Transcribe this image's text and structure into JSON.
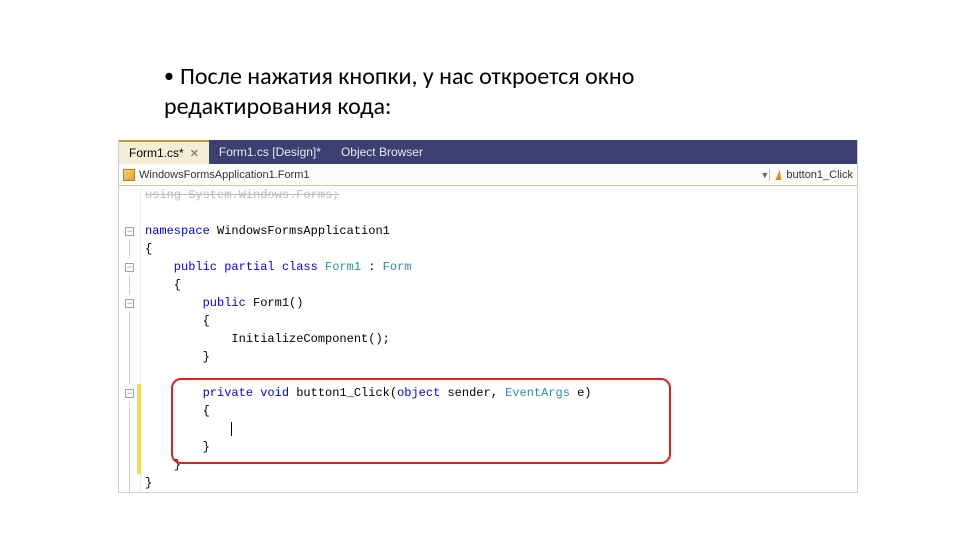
{
  "bullet_text": "После  нажатия кнопки, у нас откроется окно редактирования кода:",
  "tabs": {
    "active": "Form1.cs*",
    "design": "Form1.cs [Design]*",
    "browser": "Object Browser"
  },
  "nav": {
    "scope": "WindowsFormsApplication1.Form1",
    "member": "button1_Click"
  },
  "code": {
    "l0": "using System.Windows.Forms;",
    "l1_kw": "namespace",
    "l1_name": " WindowsFormsApplication1",
    "l2": "{",
    "l3_kw": "    public partial class",
    "l3_typ": " Form1",
    "l3_tail": " : ",
    "l3_base": "Form",
    "l4": "    {",
    "l5_kw": "        public",
    "l5_name": " Form1()",
    "l6": "        {",
    "l7": "            InitializeComponent();",
    "l8": "        }",
    "l9": "",
    "l10_kw": "        private void",
    "l10_name": " button1_Click(",
    "l10_obj": "object",
    "l10_mid": " sender, ",
    "l10_ea": "EventArgs",
    "l10_end": " e)",
    "l11": "        {",
    "l12": "            ",
    "l13": "        }",
    "l14": "    }",
    "l15": "}"
  }
}
